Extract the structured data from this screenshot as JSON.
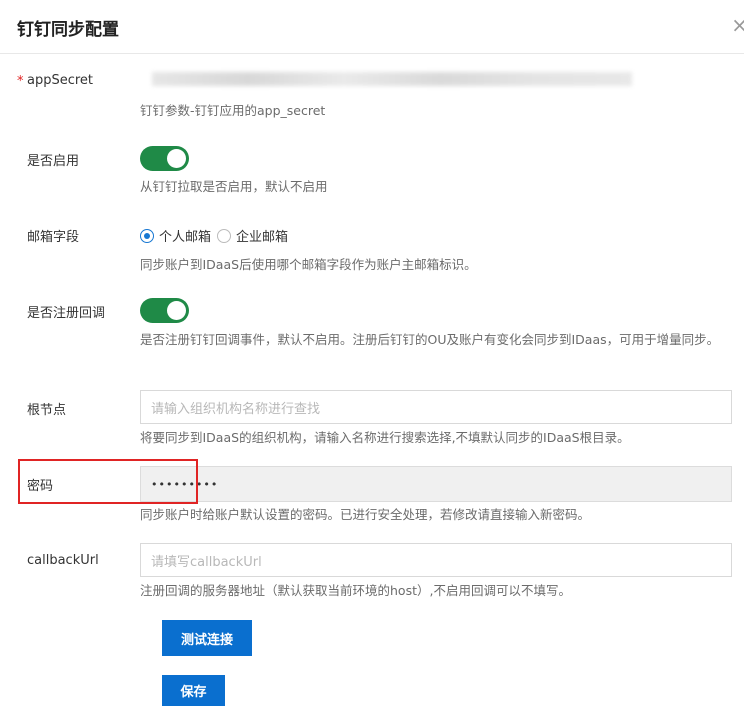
{
  "header": {
    "title": "钉钉同步配置",
    "close_glyph": "×"
  },
  "form": {
    "app_secret": {
      "label": "appSecret",
      "required_mark": "*",
      "help": "钉钉参数-钉钉应用的app_secret"
    },
    "enabled": {
      "label": "是否启用",
      "value": true,
      "help": "从钉钉拉取是否启用，默认不启用"
    },
    "email_field": {
      "label": "邮箱字段",
      "options": [
        "个人邮箱",
        "企业邮箱"
      ],
      "selected": "个人邮箱",
      "help": "同步账户到IDaaS后使用哪个邮箱字段作为账户主邮箱标识。"
    },
    "register_callback": {
      "label": "是否注册回调",
      "value": true,
      "help": "是否注册钉钉回调事件，默认不启用。注册后钉钉的OU及账户有变化会同步到IDaas，可用于增量同步。"
    },
    "root_node": {
      "label": "根节点",
      "placeholder": "请输入组织机构名称进行查找",
      "help": "将要同步到IDaaS的组织机构，请输入名称进行搜索选择,不填默认同步的IDaaS根目录。"
    },
    "password": {
      "label": "密码",
      "value": "•••••••••",
      "help": "同步账户时给账户默认设置的密码。已进行安全处理，若修改请直接输入新密码。"
    },
    "callback_url": {
      "label": "callbackUrl",
      "placeholder": "请填写callbackUrl",
      "help": "注册回调的服务器地址（默认获取当前环境的host）,不启用回调可以不填写。"
    }
  },
  "actions": {
    "test_connection": "测试连接",
    "save": "保存"
  },
  "colors": {
    "primary": "#0a6fcf",
    "toggle_on": "#1f8a47",
    "required": "#e02020",
    "highlight": "#e02424"
  }
}
